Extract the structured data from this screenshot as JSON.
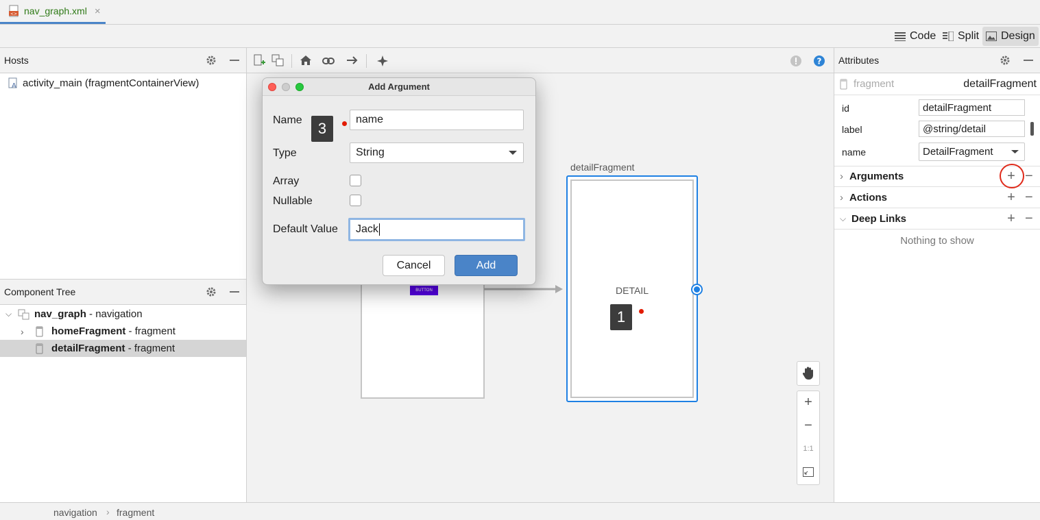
{
  "tab": {
    "filename": "nav_graph.xml",
    "close": "×"
  },
  "view_modes": {
    "code": "Code",
    "split": "Split",
    "design": "Design"
  },
  "hosts": {
    "title": "Hosts",
    "items": [
      "activity_main (fragmentContainerView)"
    ]
  },
  "component_tree": {
    "title": "Component Tree",
    "rows": [
      {
        "name": "nav_graph",
        "suffix": " - navigation"
      },
      {
        "name": "homeFragment",
        "suffix": " - fragment"
      },
      {
        "name": "detailFragment",
        "suffix": " - fragment"
      }
    ]
  },
  "canvas": {
    "detail_label": "detailFragment",
    "detail_text": "DETAIL",
    "home_button": "BUTTON",
    "marker1": "1",
    "zoom_fit": "1:1"
  },
  "dialog": {
    "title": "Add Argument",
    "name_label": "Name",
    "name_value": "name",
    "type_label": "Type",
    "type_value": "String",
    "array_label": "Array",
    "nullable_label": "Nullable",
    "default_label": "Default Value",
    "default_value": "Jack",
    "cancel": "Cancel",
    "add": "Add",
    "marker3": "3"
  },
  "attributes": {
    "title": "Attributes",
    "type": "fragment",
    "id_header": "detailFragment",
    "fields": {
      "id_label": "id",
      "id_value": "detailFragment",
      "label_label": "label",
      "label_value": "@string/detail",
      "name_label": "name",
      "name_value": "DetailFragment"
    },
    "sections": {
      "arguments": "Arguments",
      "actions": "Actions",
      "deep_links": "Deep Links"
    },
    "empty": "Nothing to show"
  },
  "breadcrumb": {
    "first": "navigation",
    "second": "fragment"
  },
  "colors": {
    "accent": "#4a84c8",
    "highlight": "#e02a1a",
    "selection": "#1e80e3"
  }
}
